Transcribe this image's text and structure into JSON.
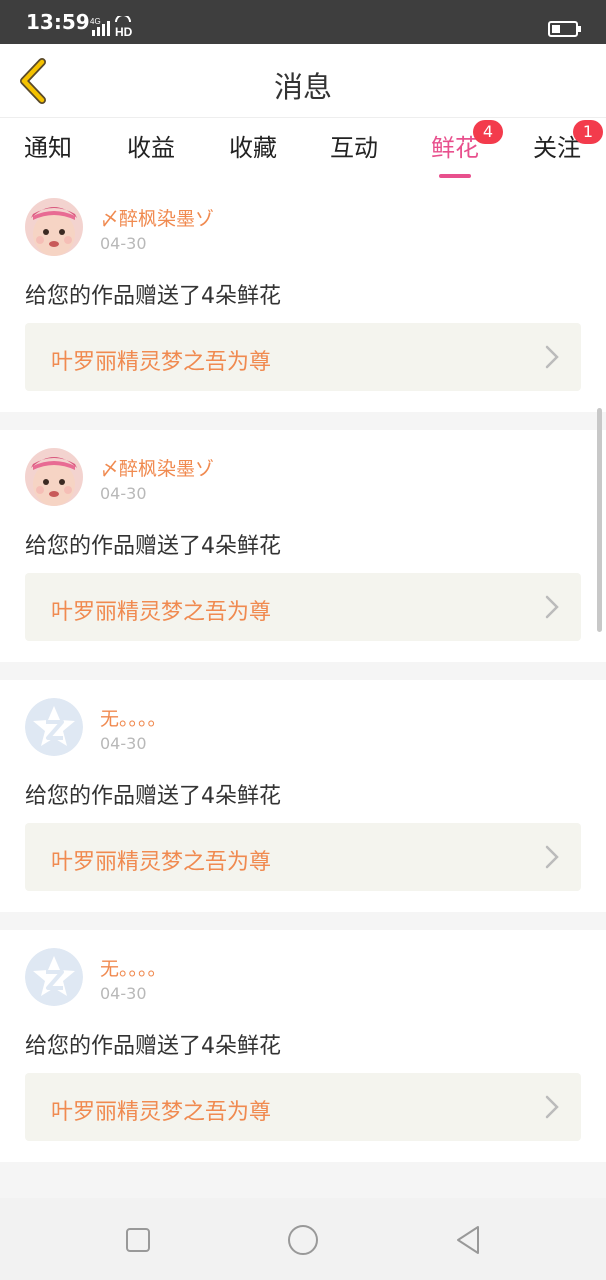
{
  "status": {
    "time": "13:59",
    "network": "4G",
    "hd": "HD",
    "battery_level": 0.35
  },
  "header": {
    "title": "消息"
  },
  "tabs": [
    {
      "label": "通知",
      "active": false,
      "badge": ""
    },
    {
      "label": "收益",
      "active": false,
      "badge": ""
    },
    {
      "label": "收藏",
      "active": false,
      "badge": ""
    },
    {
      "label": "互动",
      "active": false,
      "badge": ""
    },
    {
      "label": "鲜花",
      "active": true,
      "badge": "4"
    },
    {
      "label": "关注",
      "active": false,
      "badge": "1"
    }
  ],
  "items": [
    {
      "username": "〆醉枫染墨ゾ",
      "date": "04-30",
      "message": "给您的作品赠送了4朵鲜花",
      "work_title": "叶罗丽精灵梦之吾为尊",
      "avatar": "baby-photo"
    },
    {
      "username": "〆醉枫染墨ゾ",
      "date": "04-30",
      "message": "给您的作品赠送了4朵鲜花",
      "work_title": "叶罗丽精灵梦之吾为尊",
      "avatar": "baby-photo"
    },
    {
      "username": "无。。。。",
      "date": "04-30",
      "message": "给您的作品赠送了4朵鲜花",
      "work_title": "叶罗丽精灵梦之吾为尊",
      "avatar": "qzone-default"
    },
    {
      "username": "无。。。。",
      "date": "04-30",
      "message": "给您的作品赠送了4朵鲜花",
      "work_title": "叶罗丽精灵梦之吾为尊",
      "avatar": "qzone-default"
    }
  ],
  "colors": {
    "accent": "#e8508d",
    "username": "#f08a50",
    "badge": "#f33b4c",
    "back_icon": "#f5c200"
  },
  "nav": {
    "icons": [
      "square-icon",
      "circle-icon",
      "triangle-back-icon"
    ]
  }
}
